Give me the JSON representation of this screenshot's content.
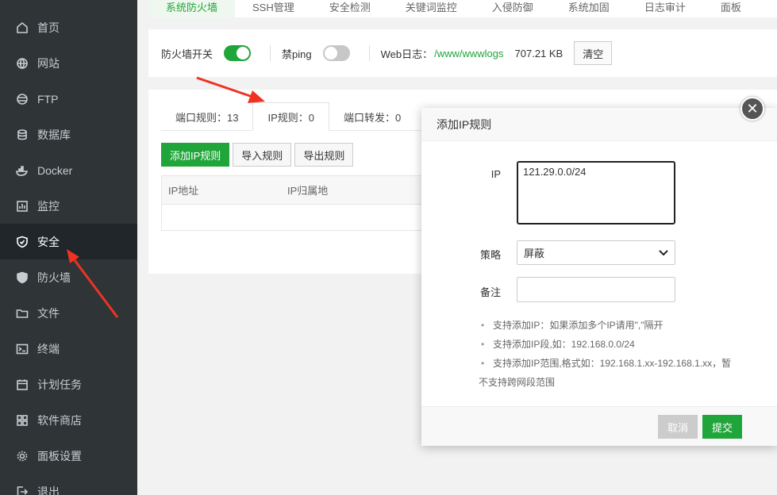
{
  "sidebar": {
    "items": [
      {
        "label": "首页",
        "icon": "home-icon"
      },
      {
        "label": "网站",
        "icon": "globe-icon"
      },
      {
        "label": "FTP",
        "icon": "ftp-icon"
      },
      {
        "label": "数据库",
        "icon": "database-icon"
      },
      {
        "label": "Docker",
        "icon": "docker-icon"
      },
      {
        "label": "监控",
        "icon": "monitor-icon"
      },
      {
        "label": "安全",
        "icon": "shield-icon"
      },
      {
        "label": "防火墙",
        "icon": "firewall-icon"
      },
      {
        "label": "文件",
        "icon": "folder-icon"
      },
      {
        "label": "终端",
        "icon": "terminal-icon"
      },
      {
        "label": "计划任务",
        "icon": "calendar-icon"
      },
      {
        "label": "软件商店",
        "icon": "apps-icon"
      },
      {
        "label": "面板设置",
        "icon": "gear-icon"
      },
      {
        "label": "退出",
        "icon": "logout-icon"
      }
    ],
    "active_label": "安全"
  },
  "topnav": {
    "tabs": [
      "系统防火墙",
      "SSH管理",
      "安全检测",
      "关键词监控",
      "入侵防御",
      "系统加固",
      "日志审计",
      "面板"
    ]
  },
  "firewall_bar": {
    "firewall_switch_label": "防火墙开关",
    "firewall_on": true,
    "ping_label": "禁ping",
    "ping_on": false,
    "weblog_label": "Web日志：",
    "weblog_path": "/www/wwwlogs",
    "weblog_size": "707.21 KB",
    "clear_label": "清空"
  },
  "rules_panel": {
    "tabs": [
      "端口规则：13",
      "IP规则：0",
      "端口转发：0"
    ],
    "active_tab": "IP规则：0",
    "add_label": "添加IP规则",
    "import_label": "导入规则",
    "export_label": "导出规则",
    "columns": [
      "IP地址",
      "IP归属地"
    ]
  },
  "modal": {
    "title": "添加IP规则",
    "close_glyph": "✕",
    "ip_label": "IP",
    "ip_value": "121.29.0.0/24",
    "policy_label": "策略",
    "policy_value": "屏蔽",
    "note_label": "备注",
    "note_value": "",
    "tips": [
      "支持添加IP：如果添加多个IP请用\",\"隔开",
      "支持添加IP段,如：192.168.0.0/24",
      "支持添加IP范围,格式如：192.168.1.xx-192.168.1.xx，暂不支持跨网段范围"
    ],
    "cancel_label": "取消",
    "submit_label": "提交"
  },
  "colors": {
    "accent": "#20a53a",
    "sidebar_bg": "#2f3437",
    "arrow": "#ee3322"
  }
}
